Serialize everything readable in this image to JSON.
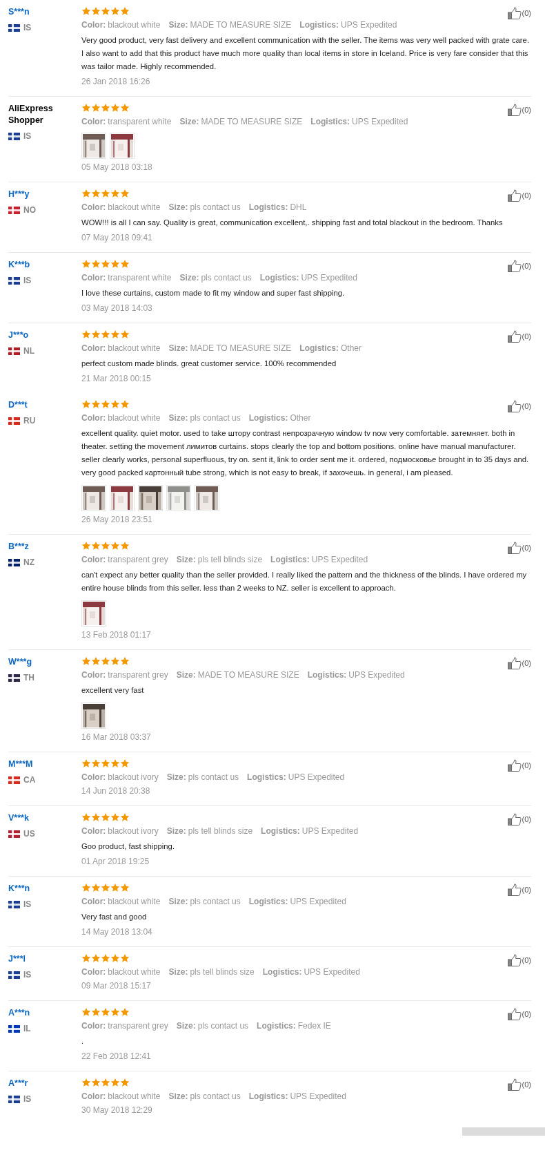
{
  "reviews": [
    {
      "name": "S***n",
      "masked": true,
      "country": "IS",
      "color": "#1c3f94",
      "stars": 5,
      "attributes": [
        {
          "label": "Color:",
          "value": "blackout white"
        },
        {
          "label": "Size:",
          "value": "MADE TO MEASURE SIZE"
        },
        {
          "label": "Logistics:",
          "value": "UPS Expedited"
        }
      ],
      "text": "Very good product, very fast delivery and excellent communication with the seller. The items was very well packed with grate care. I also want to add that this product have much more quality than local items in store in Iceland. Price is very fare consider that this was tailor made. Highly recommended.",
      "date": "26 Jan 2018 16:26",
      "likes": "(0)",
      "divider": true
    },
    {
      "name": "AliExpress Shopper",
      "masked": false,
      "country": "IS",
      "color": "#1c3f94",
      "stars": 5,
      "attributes": [
        {
          "label": "Color:",
          "value": "transparent white"
        },
        {
          "label": "Size:",
          "value": "MADE TO MEASURE SIZE"
        },
        {
          "label": "Logistics:",
          "value": "UPS Expedited"
        }
      ],
      "photos": [
        {
          "kind": "picture"
        },
        {
          "kind": "picture"
        }
      ],
      "date": "05 May 2018 03:18",
      "likes": "(0)",
      "divider": true
    },
    {
      "name": "H***y",
      "masked": true,
      "country": "NO",
      "color": "#c8202e",
      "stars": 5,
      "attributes": [
        {
          "label": "Color:",
          "value": "blackout white"
        },
        {
          "label": "Size:",
          "value": "pls contact us"
        },
        {
          "label": "Logistics:",
          "value": "DHL"
        }
      ],
      "text": "WOW!!! is all I can say. Quality is great, communication excellent,. shipping fast and total blackout in the bedroom. Thanks",
      "date": "07 May 2018 09:41",
      "likes": "(0)",
      "divider": true
    },
    {
      "name": "K***b",
      "masked": true,
      "country": "IS",
      "color": "#1c3f94",
      "stars": 5,
      "attributes": [
        {
          "label": "Color:",
          "value": "transparent white"
        },
        {
          "label": "Size:",
          "value": "pls contact us"
        },
        {
          "label": "Logistics:",
          "value": "UPS Expedited"
        }
      ],
      "text": "I love these curtains, custom made to fit my window and super fast shipping.",
      "date": "03 May 2018 14:03",
      "likes": "(0)",
      "divider": true
    },
    {
      "name": "J***o",
      "masked": true,
      "country": "NL",
      "color": "#ae1c28",
      "stars": 5,
      "attributes": [
        {
          "label": "Color:",
          "value": "blackout white"
        },
        {
          "label": "Size:",
          "value": "MADE TO MEASURE SIZE"
        },
        {
          "label": "Logistics:",
          "value": "Other"
        }
      ],
      "text": "perfect custom made blinds. great customer service. 100% recommended",
      "date": "21 Mar 2018 00:15",
      "likes": "(0)",
      "divider": false
    },
    {
      "name": "D***t",
      "masked": true,
      "country": "RU",
      "color": "#d52b1e",
      "stars": 5,
      "attributes": [
        {
          "label": "Color:",
          "value": "blackout white"
        },
        {
          "label": "Size:",
          "value": "pls contact us"
        },
        {
          "label": "Logistics:",
          "value": "Other"
        }
      ],
      "text": "excellent quality. quiet motor. used to take штору contrast непрозрачную window tv now very comfortable. затемняет. both in theater. setting the movement лимитов curtains. stops clearly the top and bottom positions. online have manual manufacturer. seller clearly works, personal superfluous, try on. sent it, link to order sent me it. ordered, подмосковье brought in to 35 days and. very good packed картонный tube strong, which is not easy to break, if захочешь. in general, i am pleased.",
      "photos": [
        {
          "kind": "picture"
        },
        {
          "kind": "picture"
        },
        {
          "kind": "picture"
        },
        {
          "kind": "picture"
        },
        {
          "kind": "picture"
        }
      ],
      "date": "26 May 2018 23:51",
      "likes": "(0)",
      "divider": true
    },
    {
      "name": "B***z",
      "masked": true,
      "country": "NZ",
      "color": "#012169",
      "stars": 5,
      "attributes": [
        {
          "label": "Color:",
          "value": "transparent grey"
        },
        {
          "label": "Size:",
          "value": "pls tell blinds size"
        },
        {
          "label": "Logistics:",
          "value": "UPS Expedited"
        }
      ],
      "text": "can't expect any better quality than the seller provided. I really liked the pattern and the thickness of the blinds. I have ordered my entire house blinds from this seller. less than 2 weeks to NZ. seller is excellent to approach.",
      "photos": [
        {
          "kind": "picture"
        }
      ],
      "date": "13 Feb 2018 01:17",
      "likes": "(0)",
      "divider": true
    },
    {
      "name": "W***g",
      "masked": true,
      "country": "TH",
      "color": "#2d2a4a",
      "stars": 5,
      "attributes": [
        {
          "label": "Color:",
          "value": "transparent grey"
        },
        {
          "label": "Size:",
          "value": "MADE TO MEASURE SIZE"
        },
        {
          "label": "Logistics:",
          "value": "UPS Expedited"
        }
      ],
      "text": "excellent very fast",
      "photos": [
        {
          "kind": "picture"
        }
      ],
      "date": "16 Mar 2018 03:37",
      "likes": "(0)",
      "divider": true
    },
    {
      "name": "M***M",
      "masked": true,
      "country": "CA",
      "color": "#d52b1e",
      "stars": 5,
      "attributes": [
        {
          "label": "Color:",
          "value": "blackout ivory"
        },
        {
          "label": "Size:",
          "value": "pls contact us"
        },
        {
          "label": "Logistics:",
          "value": "UPS Expedited"
        }
      ],
      "date": "14 Jun 2018 20:38",
      "likes": "(0)",
      "divider": true
    },
    {
      "name": "V***k",
      "masked": true,
      "country": "US",
      "color": "#b22234",
      "stars": 5,
      "attributes": [
        {
          "label": "Color:",
          "value": "blackout ivory"
        },
        {
          "label": "Size:",
          "value": "pls tell blinds size"
        },
        {
          "label": "Logistics:",
          "value": "UPS Expedited"
        }
      ],
      "text": "Goo product, fast shipping.",
      "date": "01 Apr 2018 19:25",
      "likes": "(0)",
      "divider": true
    },
    {
      "name": "K***n",
      "masked": true,
      "country": "IS",
      "color": "#1c3f94",
      "stars": 5,
      "attributes": [
        {
          "label": "Color:",
          "value": "blackout white"
        },
        {
          "label": "Size:",
          "value": "pls contact us"
        },
        {
          "label": "Logistics:",
          "value": "UPS Expedited"
        }
      ],
      "text": "Very fast and good",
      "date": "14 May 2018 13:04",
      "likes": "(0)",
      "divider": true
    },
    {
      "name": "J***l",
      "masked": true,
      "country": "IS",
      "color": "#1c3f94",
      "stars": 5,
      "attributes": [
        {
          "label": "Color:",
          "value": "blackout white"
        },
        {
          "label": "Size:",
          "value": "pls tell blinds size"
        },
        {
          "label": "Logistics:",
          "value": "UPS Expedited"
        }
      ],
      "date": "09 Mar 2018 15:17",
      "likes": "(0)",
      "divider": true
    },
    {
      "name": "A***n",
      "masked": true,
      "country": "IL",
      "color": "#0038b8",
      "stars": 5,
      "attributes": [
        {
          "label": "Color:",
          "value": "transparent grey"
        },
        {
          "label": "Size:",
          "value": "pls contact us"
        },
        {
          "label": "Logistics:",
          "value": "Fedex IE"
        }
      ],
      "text": ".",
      "date": "22 Feb 2018 12:41",
      "likes": "(0)",
      "divider": true
    },
    {
      "name": "A***r",
      "masked": true,
      "country": "IS",
      "color": "#1c3f94",
      "stars": 5,
      "attributes": [
        {
          "label": "Color:",
          "value": "blackout white"
        },
        {
          "label": "Size:",
          "value": "pls contact us"
        },
        {
          "label": "Logistics:",
          "value": "UPS Expedited"
        }
      ],
      "date": "30 May 2018 12:29",
      "likes": "(0)",
      "divider": false
    }
  ]
}
